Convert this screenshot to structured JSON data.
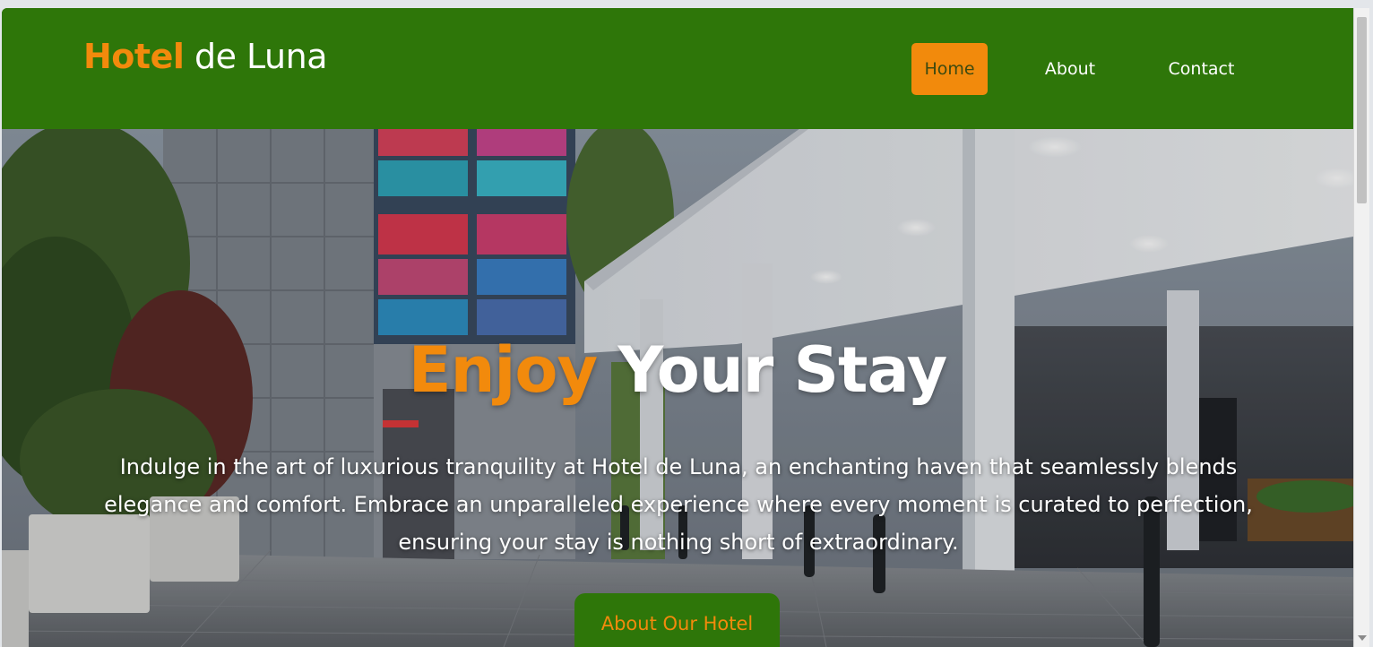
{
  "brand": {
    "name_accent": "Hotel",
    "name_rest": " de Luna"
  },
  "nav": {
    "items": [
      {
        "label": "Home",
        "active": true
      },
      {
        "label": "About",
        "active": false
      },
      {
        "label": "Contact",
        "active": false
      }
    ]
  },
  "hero": {
    "title_accent": "Enjoy",
    "title_rest": " Your Stay",
    "description": "Indulge in the art of luxurious tranquility at Hotel de Luna, an enchanting haven that seamlessly blends elegance and comfort. Embrace an unparalleled experience where every moment is curated to perfection, ensuring your stay is nothing short of extraordinary.",
    "button_label": "About Our Hotel"
  },
  "colors": {
    "primary_green": "#2e7609",
    "accent_orange": "#f28a0c",
    "text_white": "#ffffff"
  }
}
